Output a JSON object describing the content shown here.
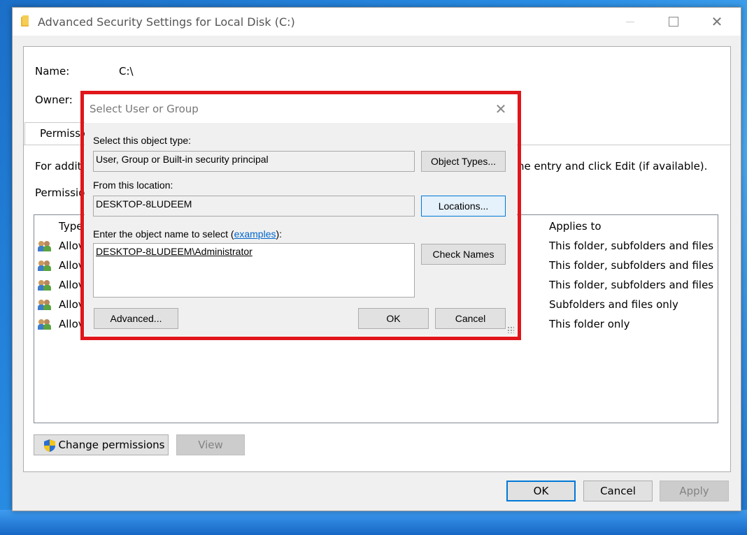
{
  "window": {
    "title": "Advanced Security Settings for Local Disk (C:)",
    "name_label": "Name:",
    "name_value": "C:\\",
    "owner_label": "Owner:",
    "tab_label": "Permissio",
    "info_text_start": "For addit",
    "info_text_end": "he entry and click Edit (if available).",
    "entries_label": "Permissio",
    "list": {
      "col_type": "Type",
      "col_applies": "Applies to",
      "rows": [
        {
          "type": "Allov",
          "applies": "This folder, subfolders and files"
        },
        {
          "type": "Allov",
          "applies": "This folder, subfolders and files"
        },
        {
          "type": "Allov",
          "applies": "This folder, subfolders and files"
        },
        {
          "type": "Allov",
          "applies": "Subfolders and files only"
        },
        {
          "type": "Allov",
          "applies": "This folder only"
        }
      ]
    },
    "change_permissions_label": "Change permissions",
    "view_label": "View",
    "ok_label": "OK",
    "cancel_label": "Cancel",
    "apply_label": "Apply"
  },
  "dialog": {
    "title": "Select User or Group",
    "object_type_label": "Select this object type:",
    "object_type_value": "User, Group or Built-in security principal",
    "object_types_button": "Object Types...",
    "location_label": "From this location:",
    "location_value": "DESKTOP-8LUDEEM",
    "locations_button": "Locations...",
    "enter_label_prefix": "Enter the object name to select (",
    "examples_link": "examples",
    "enter_label_suffix": "):",
    "object_name_value": "DESKTOP-8LUDEEM\\Administrator",
    "check_names_button": "Check Names",
    "advanced_button": "Advanced...",
    "ok_button": "OK",
    "cancel_button": "Cancel"
  },
  "colors": {
    "highlight_frame": "#e0161b",
    "accent": "#0078d7",
    "link": "#0066cc"
  }
}
